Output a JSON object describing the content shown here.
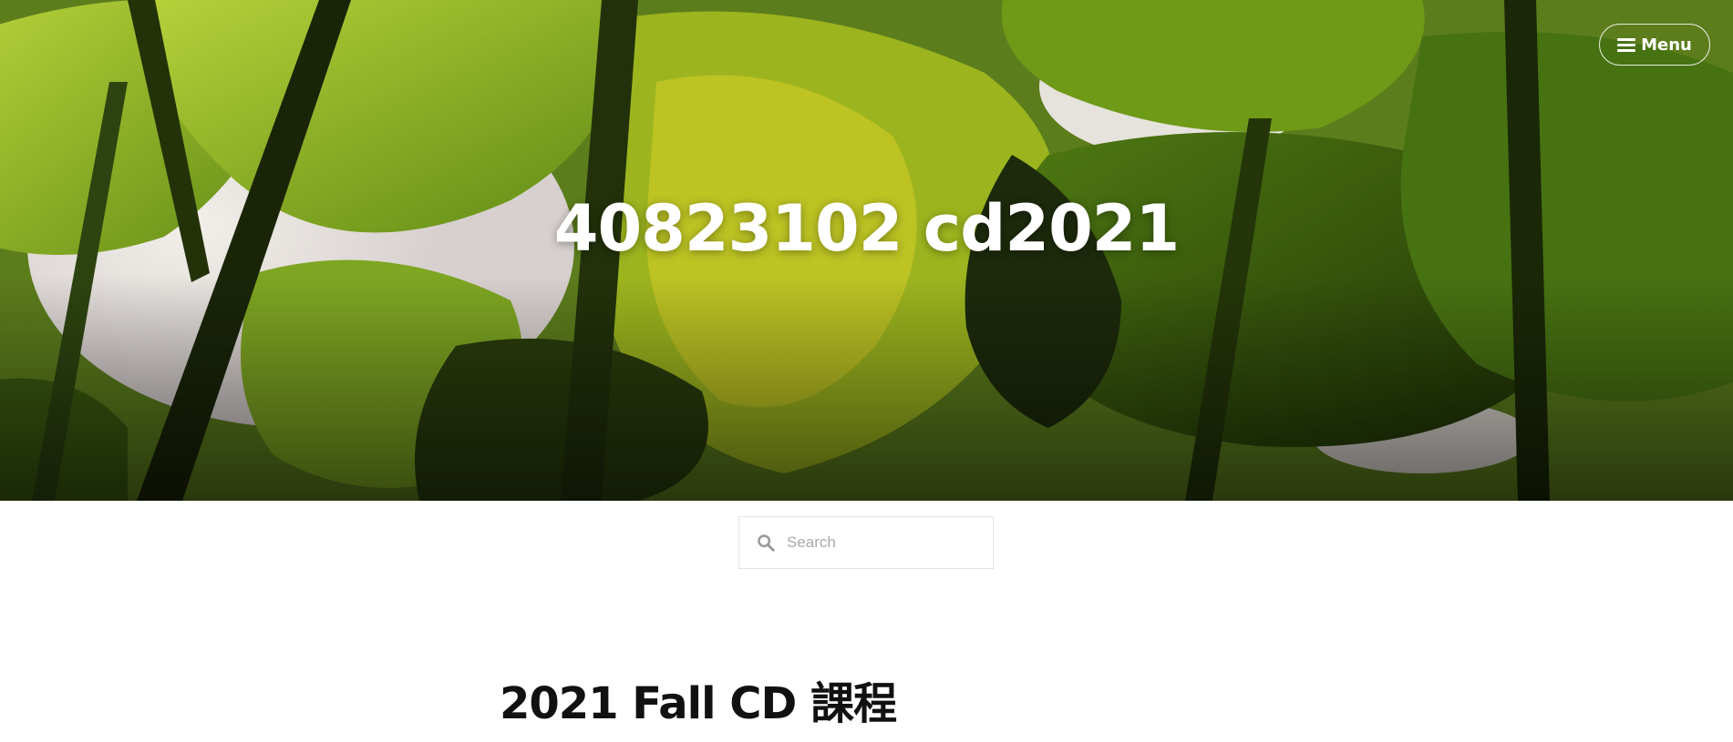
{
  "site": {
    "title": "40823102 cd2021"
  },
  "header": {
    "menu_label": "Menu"
  },
  "search": {
    "placeholder": "Search",
    "value": ""
  },
  "post": {
    "title": "2021 Fall CD 課程"
  },
  "colors": {
    "hero_green": "#5e7d20",
    "hero_dark": "#1b2408",
    "text_dark": "#111111",
    "search_border": "#e3e3e3",
    "placeholder_gray": "#a9a9a9"
  },
  "icons": {
    "menu": "hamburger-icon",
    "search": "magnifier-icon"
  }
}
